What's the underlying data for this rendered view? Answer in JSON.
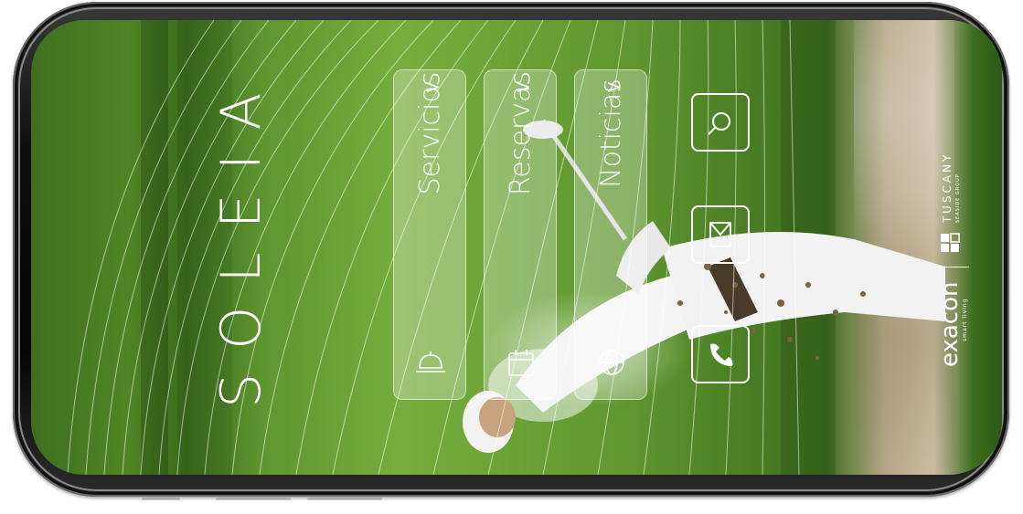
{
  "app": {
    "brand_name": "SOLEIA"
  },
  "menu": {
    "cards": [
      {
        "label": "Servicios",
        "chevron": ">",
        "icon": "bell-icon"
      },
      {
        "label": "Reservas",
        "chevron": ">",
        "icon": "calendar-icon"
      },
      {
        "label": "Noticias",
        "chevron": ">",
        "icon": "globe-icon"
      }
    ]
  },
  "actions": [
    {
      "icon": "search-icon"
    },
    {
      "icon": "mail-icon"
    },
    {
      "icon": "phone-icon"
    }
  ],
  "sponsor": {
    "name": "exacon",
    "tagline": "smart living",
    "partner": "TUSCANY",
    "partner_sub": "SEASIDE GROUP"
  },
  "colors": {
    "text": "#ffffff",
    "card_fill": "rgba(255,255,255,0.28)",
    "grass": "#5e9630",
    "phone_frame": "#0e0e0e"
  }
}
